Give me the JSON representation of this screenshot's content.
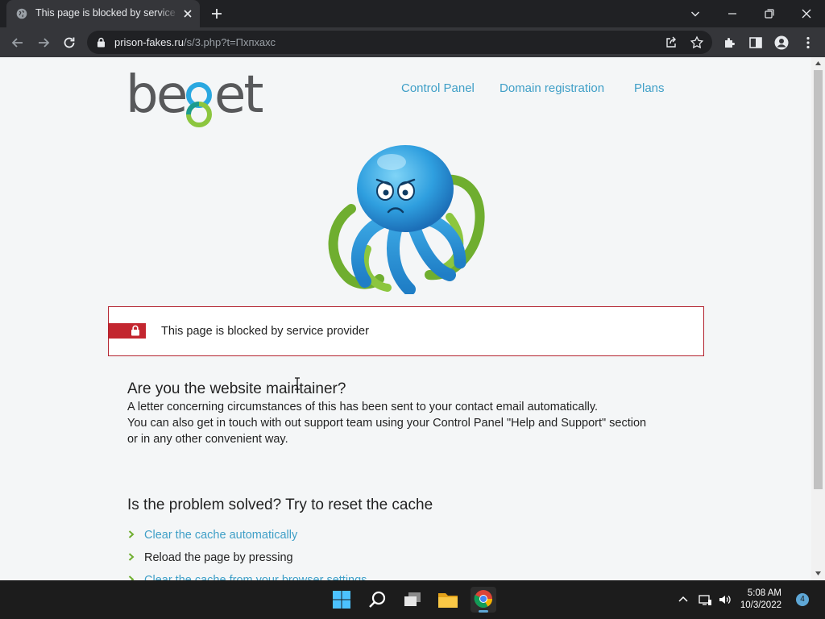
{
  "browser": {
    "tab": {
      "title": "This page is blocked by service provider"
    },
    "url": {
      "host": "prison-fakes.ru",
      "path": "/s/3.php?t=Пхпхахс"
    }
  },
  "page": {
    "logo": "beget",
    "nav": [
      "Control Panel",
      "Domain registration",
      "Plans"
    ],
    "alert": "This page is blocked by service provider",
    "maintainer": {
      "heading": "Are you the website maintainer?",
      "lines": [
        "A letter concerning circumstances of this has been sent to your contact email automatically.",
        "You can also get in touch with out support team using your Control Panel \"Help and Support\" section",
        "or in any other convenient way."
      ]
    },
    "cache": {
      "heading": "Is the problem solved? Try to reset the cache",
      "items": [
        "Clear the cache automatically",
        "Reload the page by pressing",
        "Clear the cache from your browser settings"
      ]
    },
    "colors": {
      "accent": "#3f9fc7",
      "alert": "#c3262f"
    }
  },
  "taskbar": {
    "time": "5:08 AM",
    "date": "10/3/2022",
    "notifications": "4"
  }
}
